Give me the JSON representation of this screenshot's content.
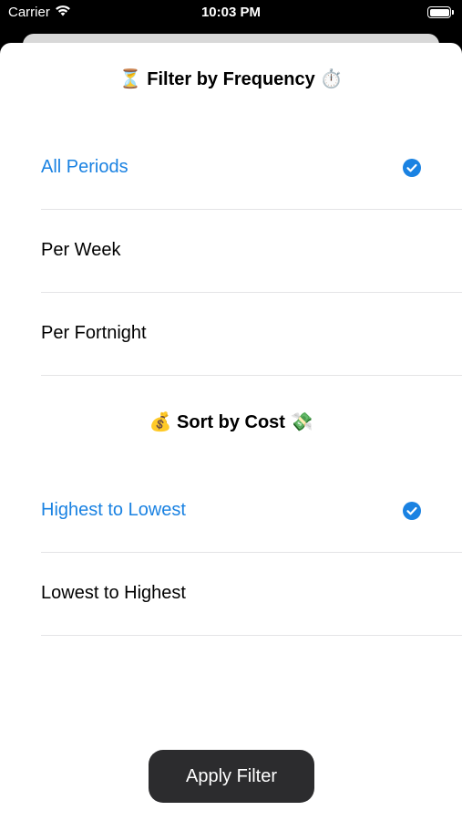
{
  "status_bar": {
    "carrier": "Carrier",
    "time": "10:03 PM",
    "wifi_icon": "wifi-icon",
    "battery_icon": "battery-full-icon"
  },
  "frequency_section": {
    "title_prefix_emoji": "⏳",
    "title": "Filter by Frequency",
    "title_suffix_emoji": "⏱️",
    "options": [
      {
        "label": "All Periods",
        "selected": true
      },
      {
        "label": "Per Week",
        "selected": false
      },
      {
        "label": "Per Fortnight",
        "selected": false
      }
    ]
  },
  "cost_section": {
    "title_prefix_emoji": "💰",
    "title": "Sort by Cost",
    "title_suffix_emoji": "💸",
    "options": [
      {
        "label": "Highest to Lowest",
        "selected": true
      },
      {
        "label": "Lowest to Highest",
        "selected": false
      }
    ]
  },
  "apply_button": {
    "label": "Apply Filter"
  },
  "colors": {
    "accent": "#1a82e2",
    "button_bg": "#2c2c2e",
    "separator": "#e4e4e6"
  }
}
